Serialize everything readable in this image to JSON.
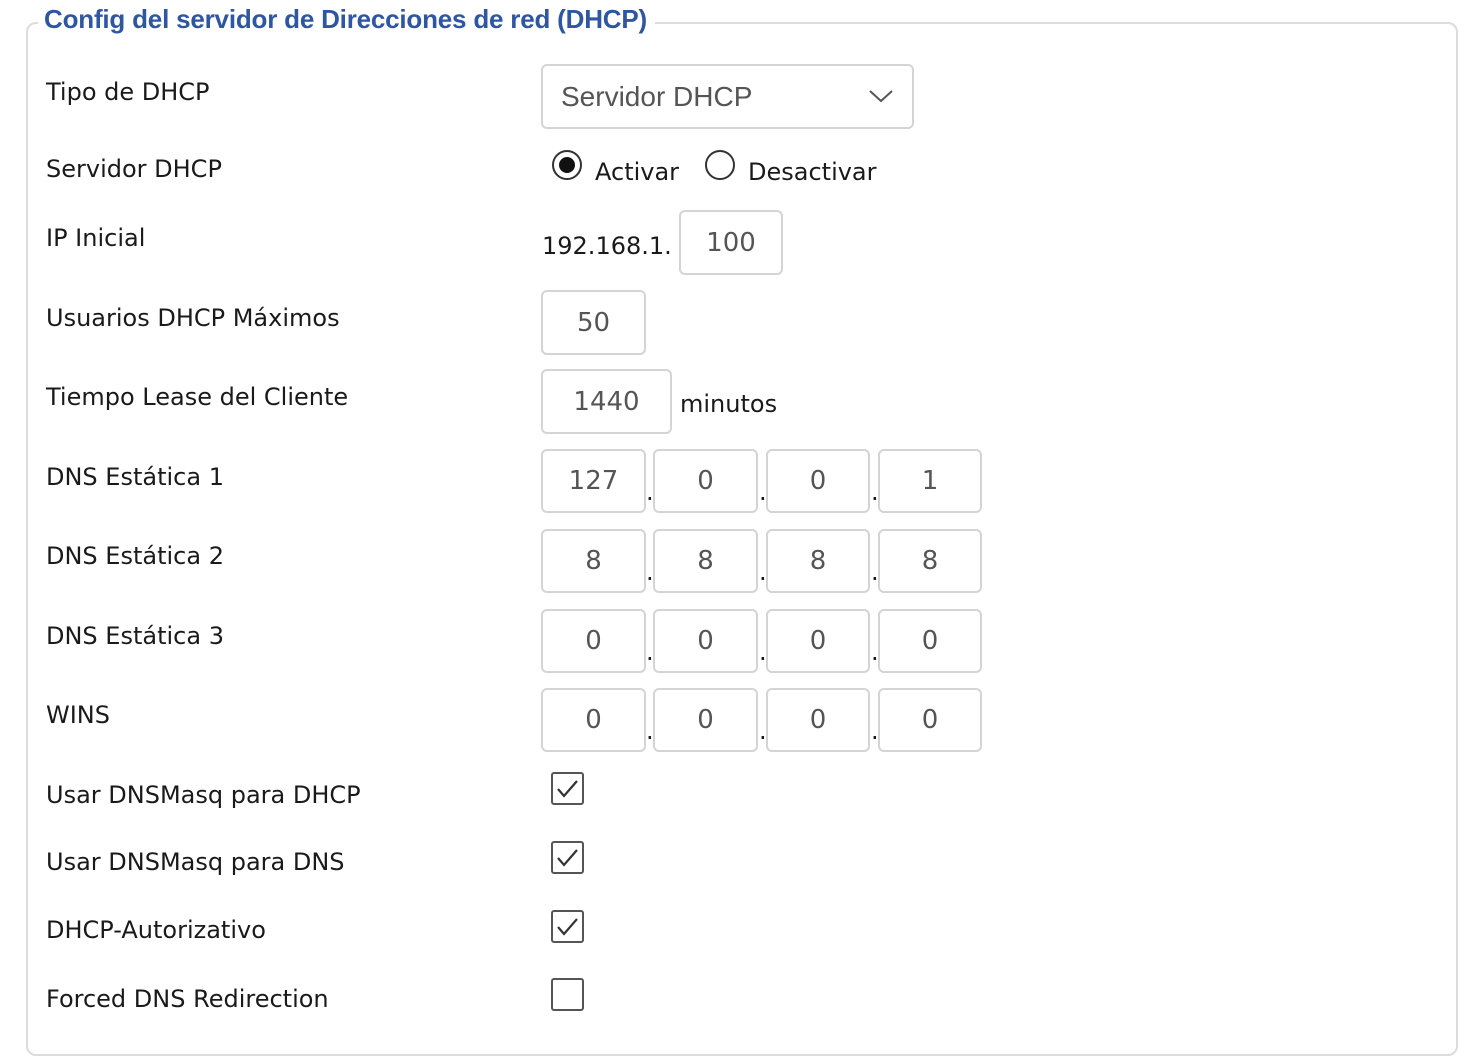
{
  "section": {
    "title": "Config del servidor de Direcciones de red (DHCP)"
  },
  "dhcp_type": {
    "label": "Tipo de DHCP",
    "value": "Servidor DHCP"
  },
  "dhcp_server": {
    "label": "Servidor DHCP",
    "options": [
      {
        "label": "Activar",
        "selected": true
      },
      {
        "label": "Desactivar",
        "selected": false
      }
    ]
  },
  "start_ip": {
    "label": "IP Inicial",
    "prefix": "192.168.1.",
    "value": "100"
  },
  "max_users": {
    "label": "Usuarios DHCP Máximos",
    "value": "50"
  },
  "lease_time": {
    "label": "Tiempo Lease del Cliente",
    "value": "1440",
    "unit": "minutos"
  },
  "dns1": {
    "label": "DNS Estática 1",
    "octets": [
      "127",
      "0",
      "0",
      "1"
    ]
  },
  "dns2": {
    "label": "DNS Estática 2",
    "octets": [
      "8",
      "8",
      "8",
      "8"
    ]
  },
  "dns3": {
    "label": "DNS Estática 3",
    "octets": [
      "0",
      "0",
      "0",
      "0"
    ]
  },
  "wins": {
    "label": "WINS",
    "octets": [
      "0",
      "0",
      "0",
      "0"
    ]
  },
  "checkboxes": [
    {
      "label": "Usar DNSMasq para DHCP",
      "checked": true
    },
    {
      "label": "Usar DNSMasq para DNS",
      "checked": true
    },
    {
      "label": "DHCP-Autorizativo",
      "checked": true
    },
    {
      "label": "Forced DNS Redirection",
      "checked": false
    }
  ],
  "icons": {
    "select_arrow": "chevron-down-icon"
  },
  "colors": {
    "legend": "#2f56a0",
    "border": "#d4d4d4",
    "input_text": "#555555"
  }
}
